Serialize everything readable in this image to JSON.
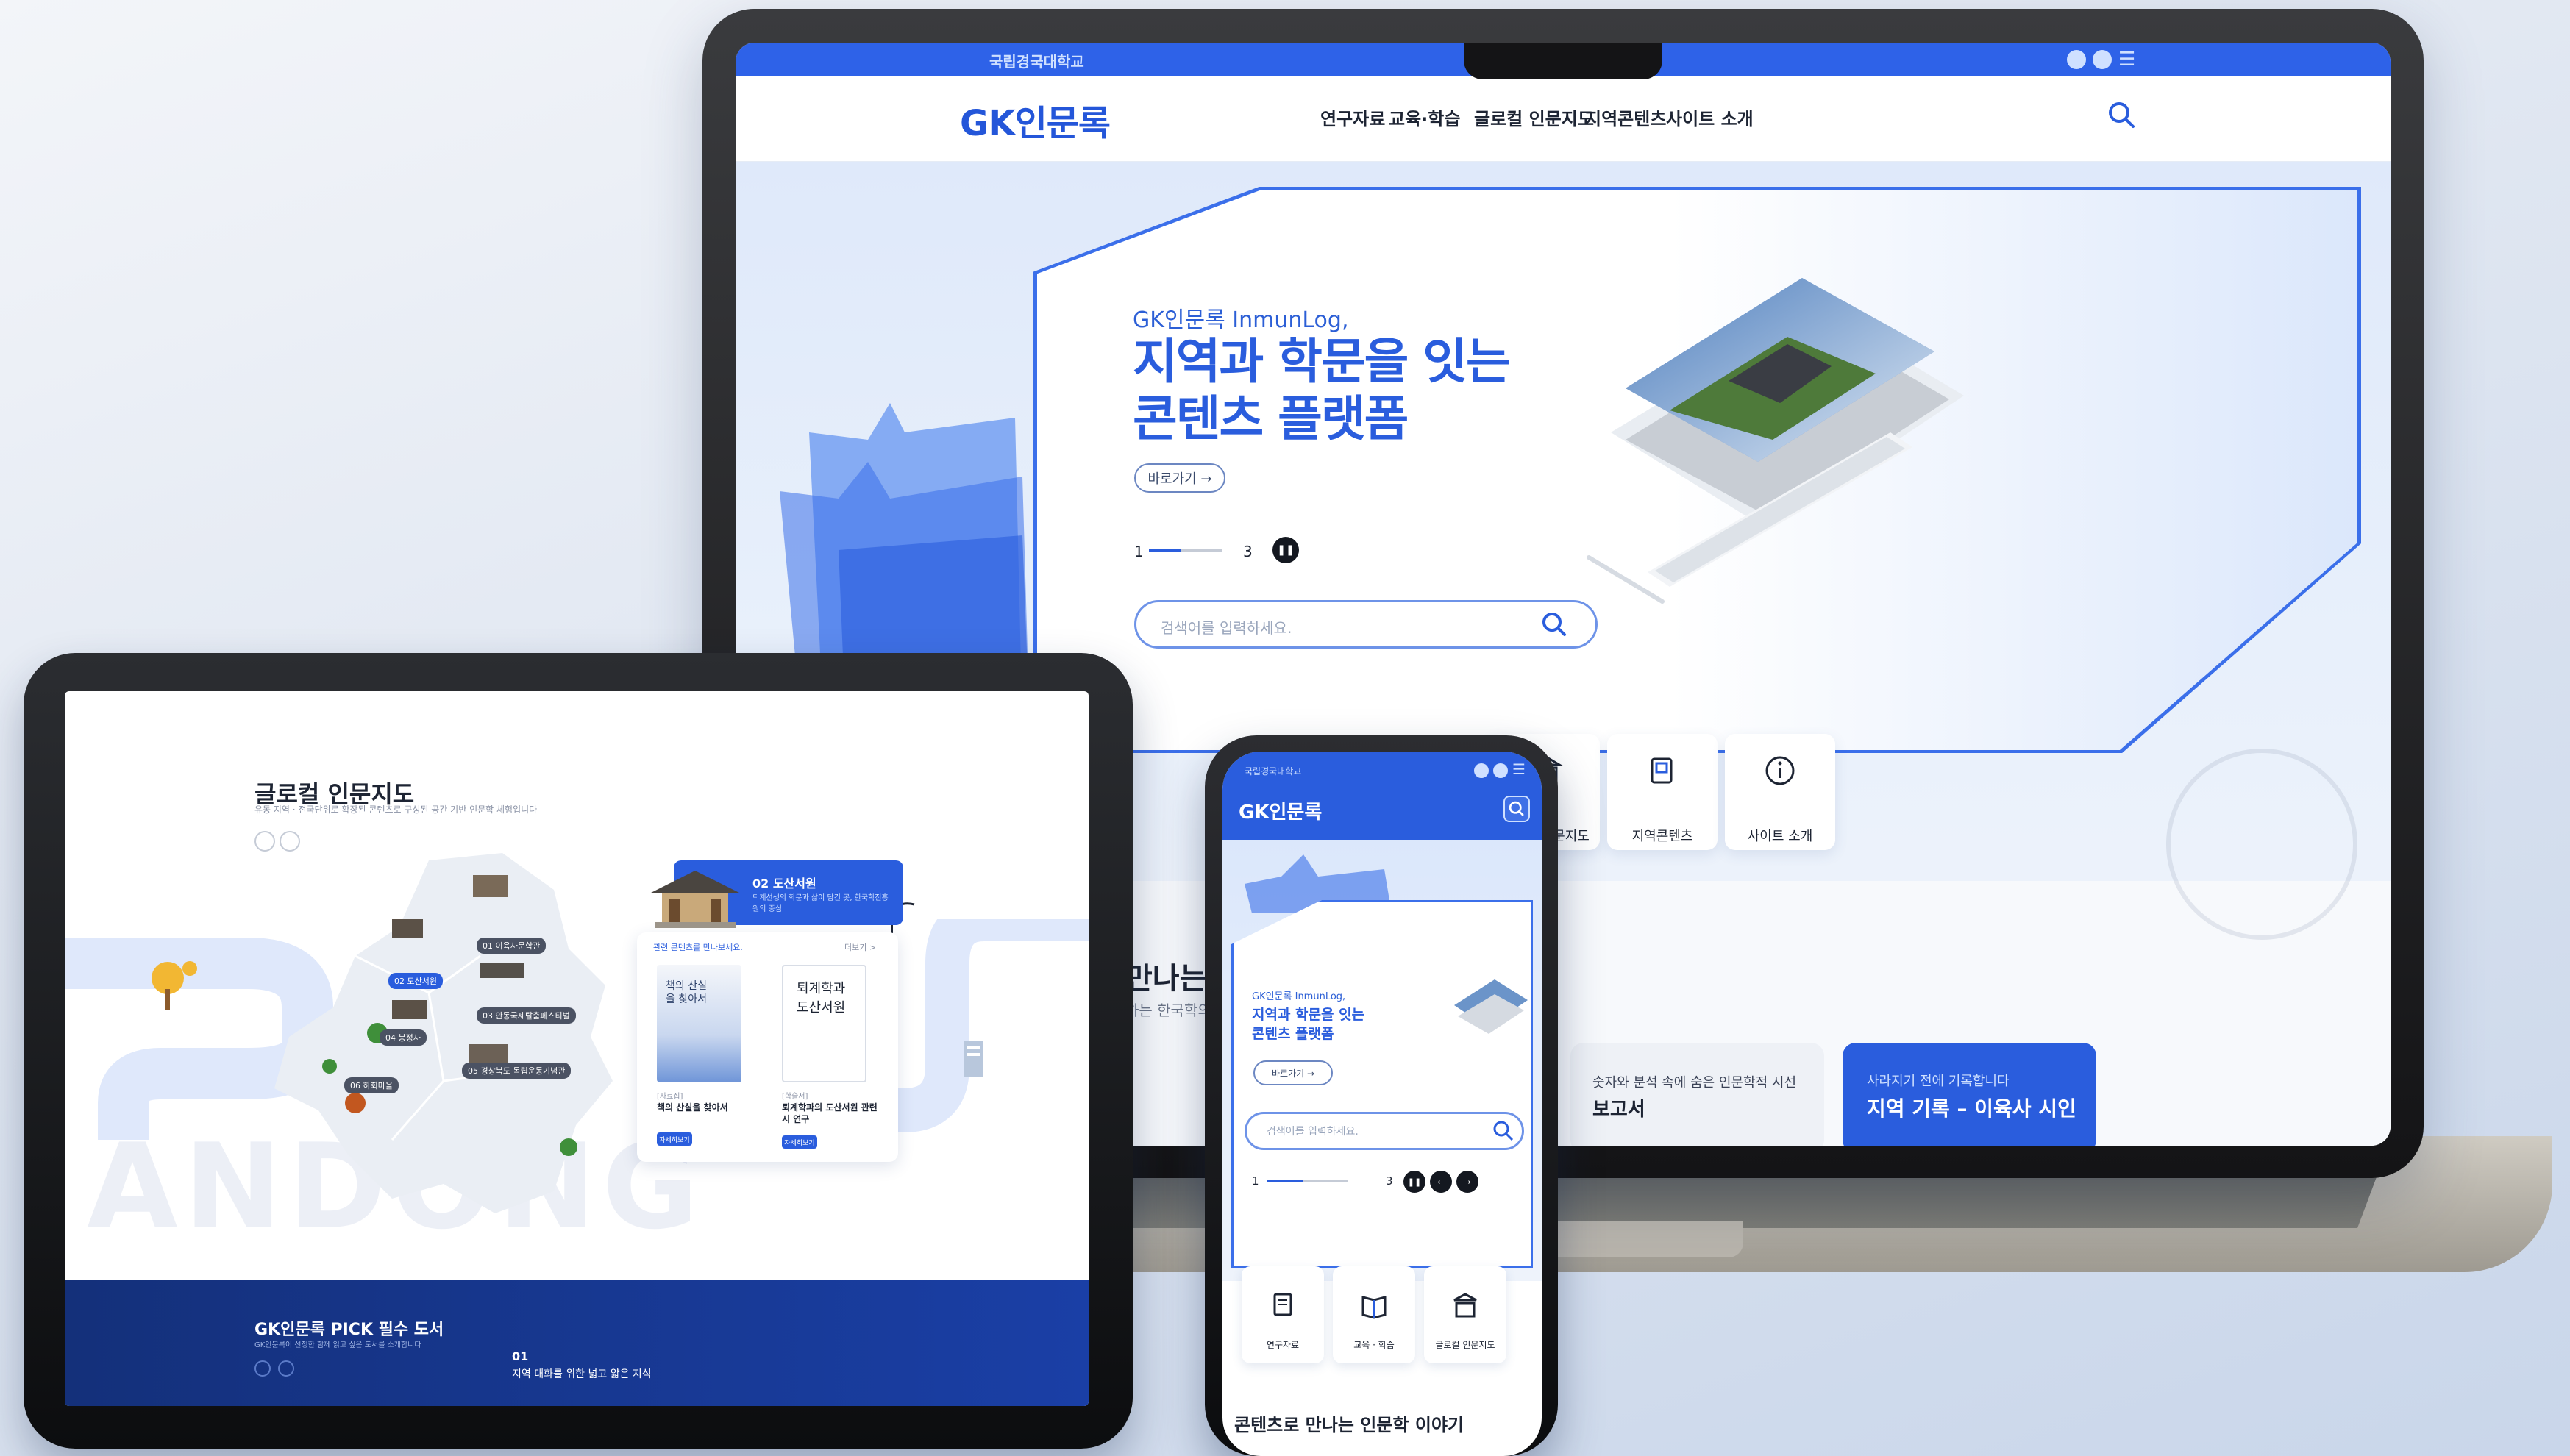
{
  "laptop": {
    "topbar_title": "국립경국대학교",
    "logo": "GK인문록",
    "nav": [
      "연구자료",
      "교육·학습",
      "글로컬 인문지도",
      "지역콘텐츠",
      "사이트 소개"
    ],
    "hero": {
      "eyebrow": "GK인문록 InmunLog,",
      "title_line1": "지역과 학문을 잇는",
      "title_line2": "콘텐츠 플랫폼",
      "cta": "바로가기 →",
      "page_current": "1",
      "page_total": "3",
      "search_placeholder": "검색어를 입력하세요."
    },
    "quick_links": [
      "글로컬 인문지도",
      "지역콘텐츠",
      "사이트 소개"
    ],
    "section_title": "만나는",
    "section_sub": "하는 한국학의 세계",
    "cards": [
      {
        "sub": "숫자와 분석 속에 숨은 인문학적 시선",
        "title": "보고서"
      },
      {
        "sub": "사라지기 전에 기록합니다",
        "title": "지역 기록 – 이육사 시인"
      }
    ]
  },
  "tablet": {
    "title": "글로컬 인문지도",
    "subtitle": "유동 지역 · 전국단위로 확장된 콘텐츠로 구성된 공간 기반 인문학 체험입니다",
    "map_labels": [
      "01 이육사문학관",
      "02 도산서원",
      "03 안동국제탈춤페스티벌",
      "04 봉정사",
      "05 경상북도 독립운동기념관",
      "06 하회마을"
    ],
    "place_card": {
      "title": "02 도산서원",
      "desc": "퇴계선생의 학문과 삶이 담긴 곳, 한국학진흥원의 중심",
      "top_label": "관련 콘텐츠를 만나보세요.",
      "more": "더보기 >",
      "books": [
        {
          "cover": "책의 산실을 찾아서",
          "category": "[자료집]",
          "title": "책의 산실을 찾아서",
          "btn": "자세히보기"
        },
        {
          "cover": "퇴계학과 도산서원",
          "category": "[학술서]",
          "title": "퇴계학파의 도산서원 관련 시 연구",
          "btn": "자세히보기"
        }
      ]
    },
    "watermark": "ANDONG",
    "pick": {
      "title": "GK인문록 PICK 필수 도서",
      "subtitle": "GK인문록이 선정한 함께 읽고 싶은 도서를 소개합니다",
      "number": "01",
      "desc": "지역 대화를 위한 넓고 얇은 지식"
    }
  },
  "phone": {
    "status": "국립경국대학교",
    "logo": "GK인문록",
    "hero_eyebrow": "GK인문록 InmunLog,",
    "hero_line1": "지역과 학문을 잇는",
    "hero_line2": "콘텐츠 플랫폼",
    "cta": "바로가기 →",
    "search_placeholder": "검색어를 입력하세요.",
    "page_current": "1",
    "page_total": "3",
    "quick_links": [
      "연구자료",
      "교육 · 학습",
      "글로컬 인문지도"
    ],
    "bottom_title": "콘텐츠로 만나는 인문학 이야기"
  },
  "colors": {
    "brand_blue": "#2a5ddd",
    "navy": "#14307a",
    "bg": "#dfe9fa"
  },
  "icons": [
    "search-icon",
    "pause-icon",
    "prev-icon",
    "next-icon",
    "hamburger-menu-icon",
    "map-icon",
    "document-icon",
    "book-icon",
    "info-icon",
    "building-icon"
  ]
}
